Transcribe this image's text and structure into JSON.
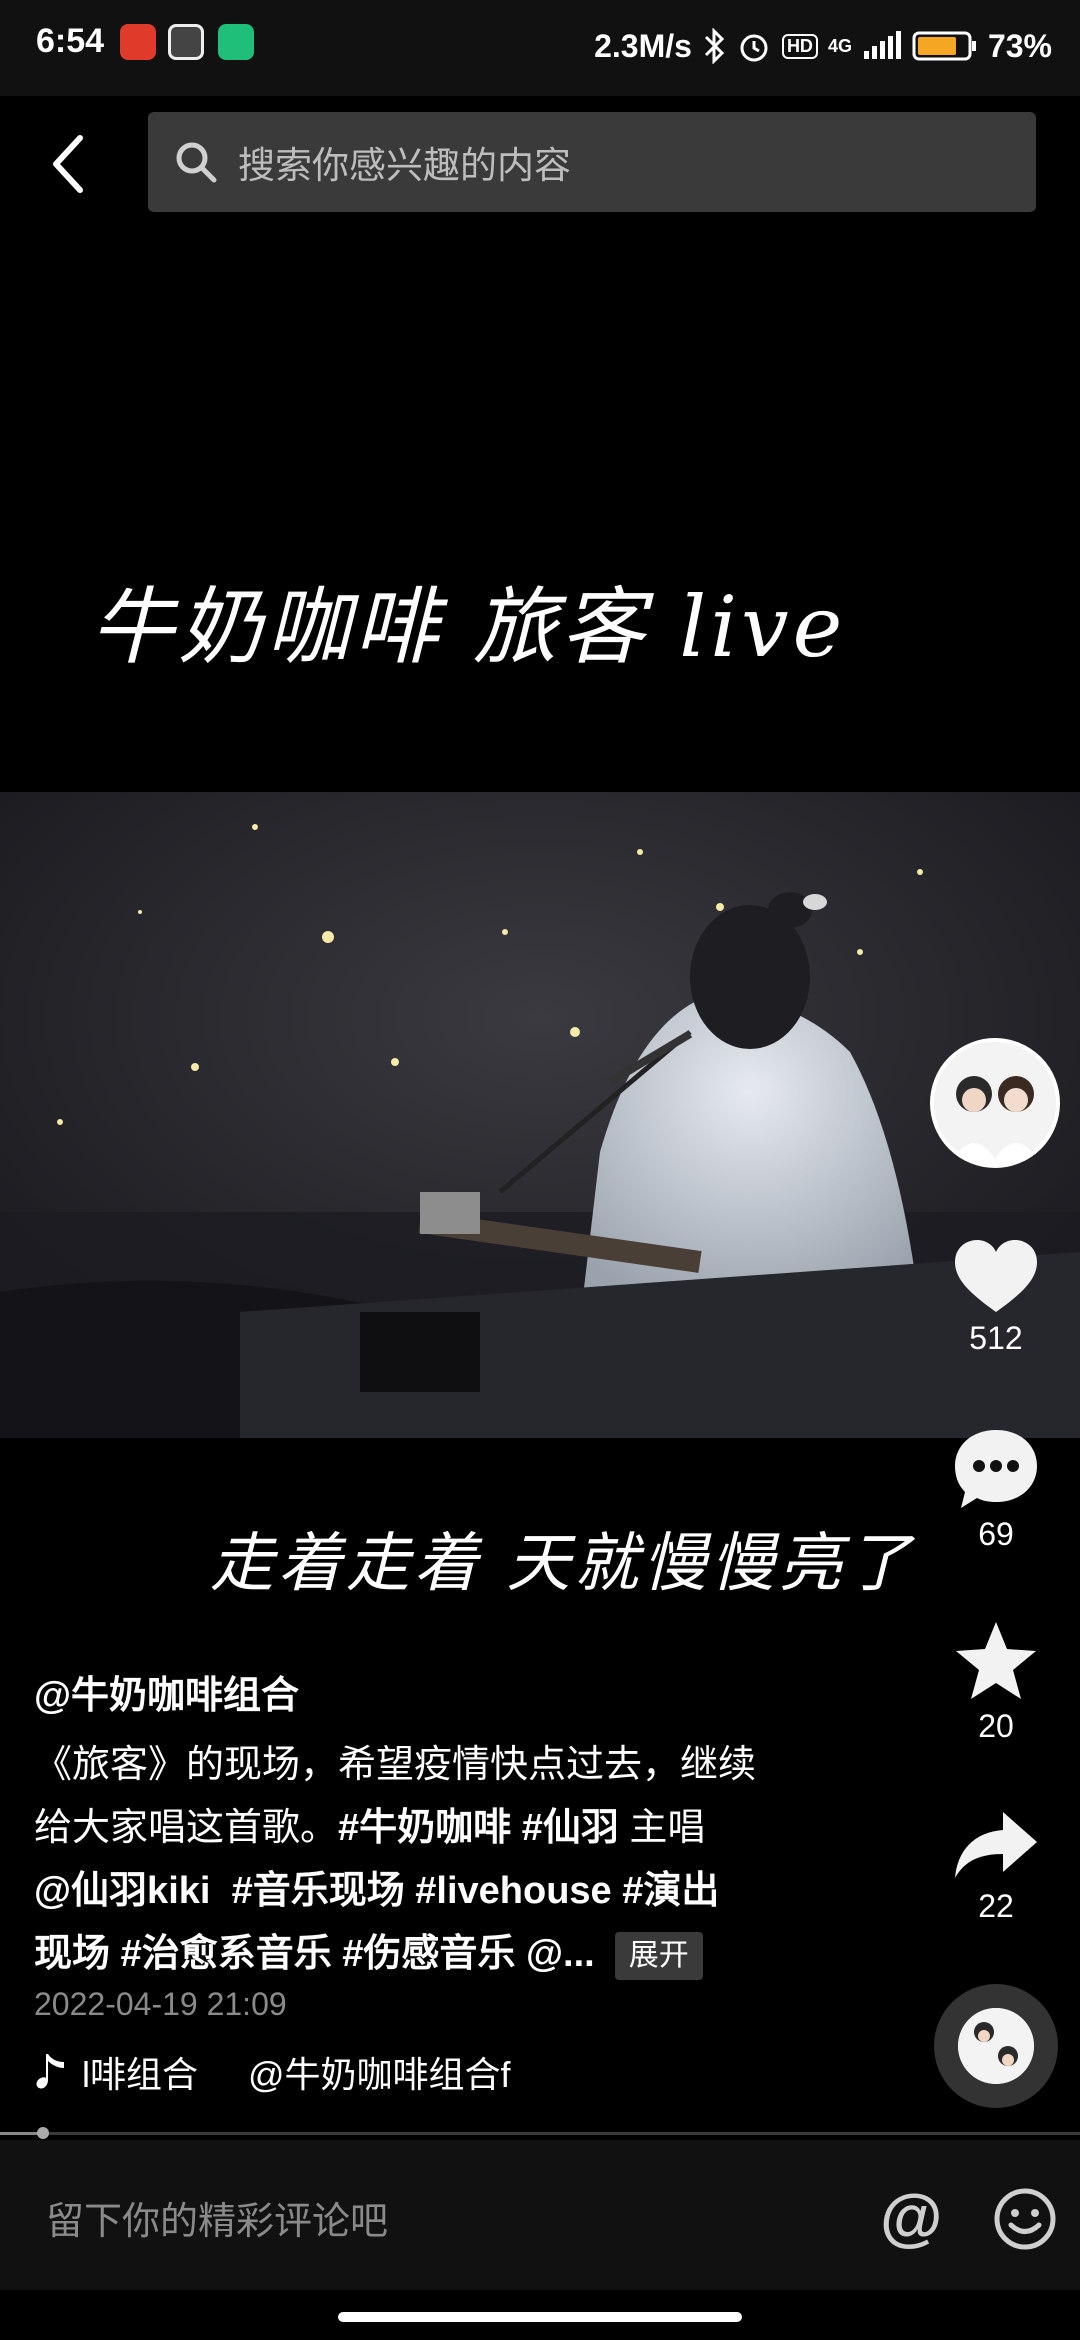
{
  "status_bar": {
    "time": "6:54",
    "network_speed": "2.3M/s",
    "hd_badge": "HD",
    "network_type": "4G",
    "battery": "73%"
  },
  "header": {
    "search_placeholder": "搜索你感兴趣的内容"
  },
  "video": {
    "title_overlay": "牛奶咖啡 旅客 live",
    "subtitle": "走着走着 天就慢慢亮了"
  },
  "rail": {
    "likes": "512",
    "comments": "69",
    "favorites": "20",
    "shares": "22"
  },
  "post": {
    "author": "@牛奶咖啡组合",
    "desc_line1": "《旅客》的现场，希望疫情快点过去，继续",
    "desc_line2_text": "给大家唱这首歌。",
    "tag_1": "#牛奶咖啡",
    "tag_2": "#仙羽",
    "desc_line2_tail": "主唱",
    "mention_1": "@仙羽kiki",
    "tag_3": "#音乐现场",
    "tag_4": "#livehouse",
    "tag_5": "#演出",
    "line4_start": "现场",
    "tag_6": "#治愈系音乐",
    "tag_7": "#伤感音乐",
    "mention_trunc": "@...",
    "expand_label": "展开",
    "date": "2022-04-19 21:09",
    "music_part1": "l啡组合",
    "music_part2": "@牛奶咖啡组合f"
  },
  "playback": {
    "progress_fraction": 0.04
  },
  "comment_bar": {
    "placeholder": "留下你的精彩评论吧",
    "at_symbol": "@"
  }
}
